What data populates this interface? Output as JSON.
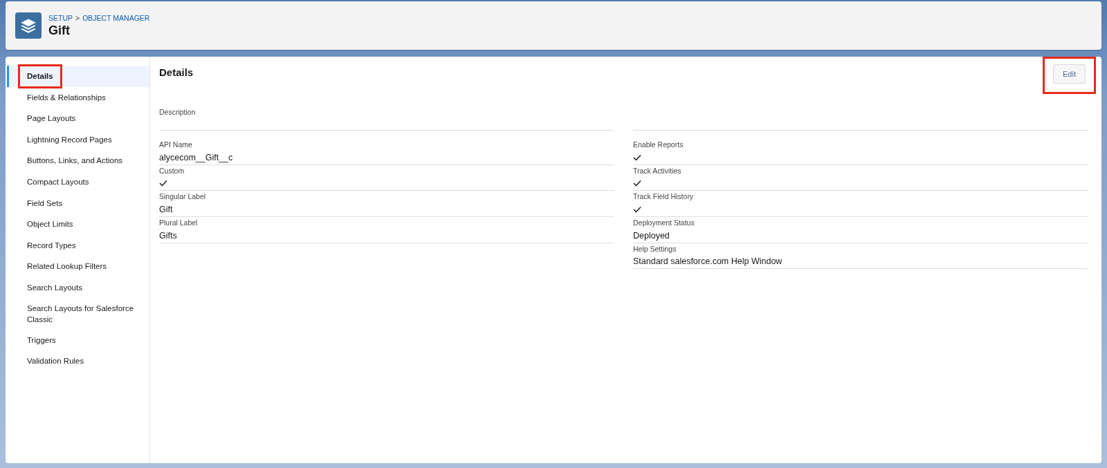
{
  "header": {
    "breadcrumb": [
      {
        "label": "SETUP"
      },
      {
        "label": "OBJECT MANAGER"
      }
    ],
    "separator": ">",
    "title": "Gift"
  },
  "sidebar": {
    "items": [
      {
        "label": "Details",
        "selected": true,
        "highlighted": true
      },
      {
        "label": "Fields & Relationships",
        "selected": false,
        "highlighted": false
      },
      {
        "label": "Page Layouts",
        "selected": false,
        "highlighted": false
      },
      {
        "label": "Lightning Record Pages",
        "selected": false,
        "highlighted": false
      },
      {
        "label": "Buttons, Links, and Actions",
        "selected": false,
        "highlighted": false
      },
      {
        "label": "Compact Layouts",
        "selected": false,
        "highlighted": false
      },
      {
        "label": "Field Sets",
        "selected": false,
        "highlighted": false
      },
      {
        "label": "Object Limits",
        "selected": false,
        "highlighted": false
      },
      {
        "label": "Record Types",
        "selected": false,
        "highlighted": false
      },
      {
        "label": "Related Lookup Filters",
        "selected": false,
        "highlighted": false
      },
      {
        "label": "Search Layouts",
        "selected": false,
        "highlighted": false
      },
      {
        "label": "Search Layouts for Salesforce Classic",
        "selected": false,
        "highlighted": false
      },
      {
        "label": "Triggers",
        "selected": false,
        "highlighted": false
      },
      {
        "label": "Validation Rules",
        "selected": false,
        "highlighted": false
      }
    ]
  },
  "details": {
    "title": "Details",
    "edit_button": {
      "label": "Edit",
      "highlighted": true
    },
    "description": {
      "label": "Description"
    },
    "left_fields": [
      {
        "kind": "text",
        "label": "API Name",
        "value": "alycecom__Gift__c"
      },
      {
        "kind": "check",
        "label": "Custom",
        "checked": true
      },
      {
        "kind": "text",
        "label": "Singular Label",
        "value": "Gift"
      },
      {
        "kind": "text",
        "label": "Plural Label",
        "value": "Gifts"
      }
    ],
    "right_fields": [
      {
        "kind": "check",
        "label": "Enable Reports",
        "checked": true
      },
      {
        "kind": "check",
        "label": "Track Activities",
        "checked": true
      },
      {
        "kind": "check",
        "label": "Track Field History",
        "checked": true
      },
      {
        "kind": "text",
        "label": "Deployment Status",
        "value": "Deployed"
      },
      {
        "kind": "text",
        "label": "Help Settings",
        "value": "Standard salesforce.com Help Window"
      }
    ]
  }
}
